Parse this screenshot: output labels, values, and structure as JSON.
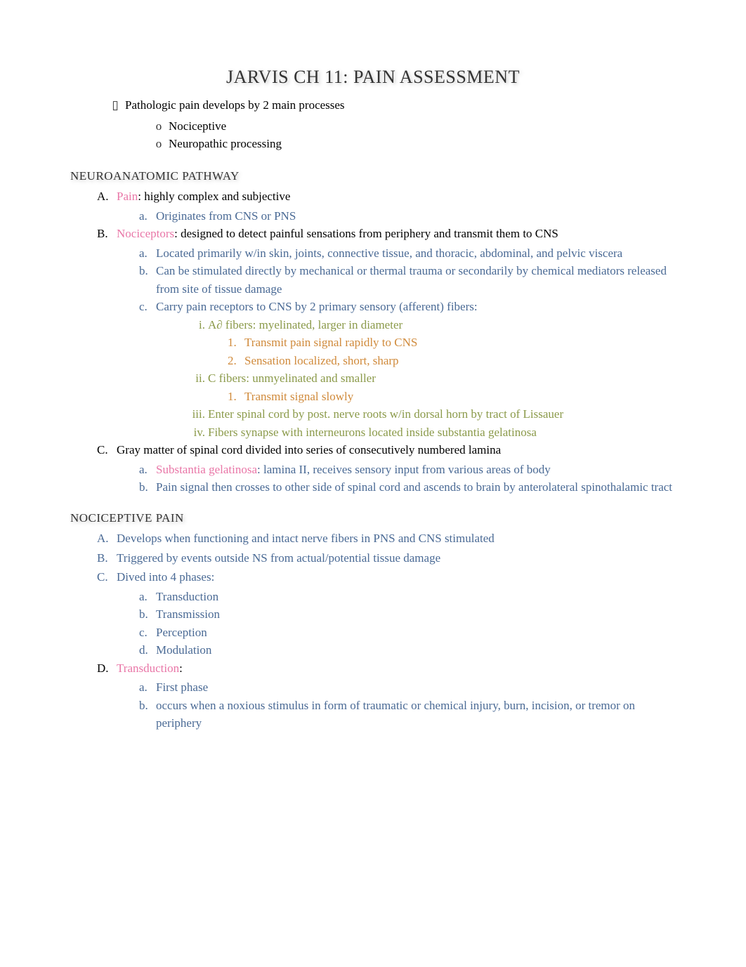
{
  "title": "JARVIS CH 11: PAIN ASSESSMENT",
  "intro": {
    "line": "Pathologic pain develops by 2 main processes",
    "subs": [
      "Nociceptive",
      "Neuropathic processing"
    ]
  },
  "sec1": {
    "heading": "NEUROANATOMIC PATHWAY",
    "A": {
      "term": "Pain",
      "rest": ": highly complex and subjective",
      "a": "Originates from CNS or PNS"
    },
    "B": {
      "term": "Nociceptors",
      "rest": ": designed to detect painful sensations from periphery and transmit them to CNS",
      "a": "Located primarily w/in skin, joints, connective tissue, and thoracic, abdominal, and pelvic viscera",
      "b": "Can be stimulated directly by mechanical or thermal trauma or secondarily by chemical mediators released from site of tissue damage",
      "c": "Carry pain receptors to CNS by 2 primary sensory (afferent) fibers:",
      "c_i": "A∂ fibers: myelinated, larger in diameter",
      "c_i_1": "Transmit pain signal rapidly to CNS",
      "c_i_2": "Sensation localized, short, sharp",
      "c_ii": "C fibers: unmyelinated and smaller",
      "c_ii_1": "Transmit signal slowly",
      "c_iii": "Enter spinal cord by post. nerve roots w/in dorsal horn by tract of Lissauer",
      "c_iv": "Fibers synapse with interneurons located inside substantia gelatinosa"
    },
    "C": {
      "text": "Gray matter of spinal cord divided into series of consecutively numbered lamina",
      "a_term": "Substantia gelatinosa",
      "a_rest": ": lamina II, receives sensory input from various areas of body",
      "b": "Pain signal then crosses to other side of spinal cord and ascends to brain by anterolateral spinothalamic tract"
    }
  },
  "sec2": {
    "heading": "NOCICEPTIVE PAIN",
    "A": "Develops when functioning and intact nerve fibers in PNS and CNS stimulated",
    "B": "Triggered by events outside NS from actual/potential tissue damage",
    "C": {
      "text": "Dived into 4 phases:",
      "a": "Transduction",
      "b": "Transmission",
      "c": "Perception",
      "d": "Modulation"
    },
    "D": {
      "term": "Transduction",
      "rest": ":",
      "a": "First phase",
      "b": "occurs when a noxious stimulus in form of traumatic or chemical injury, burn, incision, or tremor on periphery"
    }
  },
  "markers": {
    "A": "A.",
    "B": "B.",
    "C": "C.",
    "D": "D.",
    "la": "a.",
    "lb": "b.",
    "lc": "c.",
    "ld": "d.",
    "ri": "i.",
    "rii": "ii.",
    "riii": "iii.",
    "riv": "iv.",
    "n1": "1.",
    "n2": "2."
  },
  "icons": {
    "square": "▯",
    "circle": "o"
  }
}
